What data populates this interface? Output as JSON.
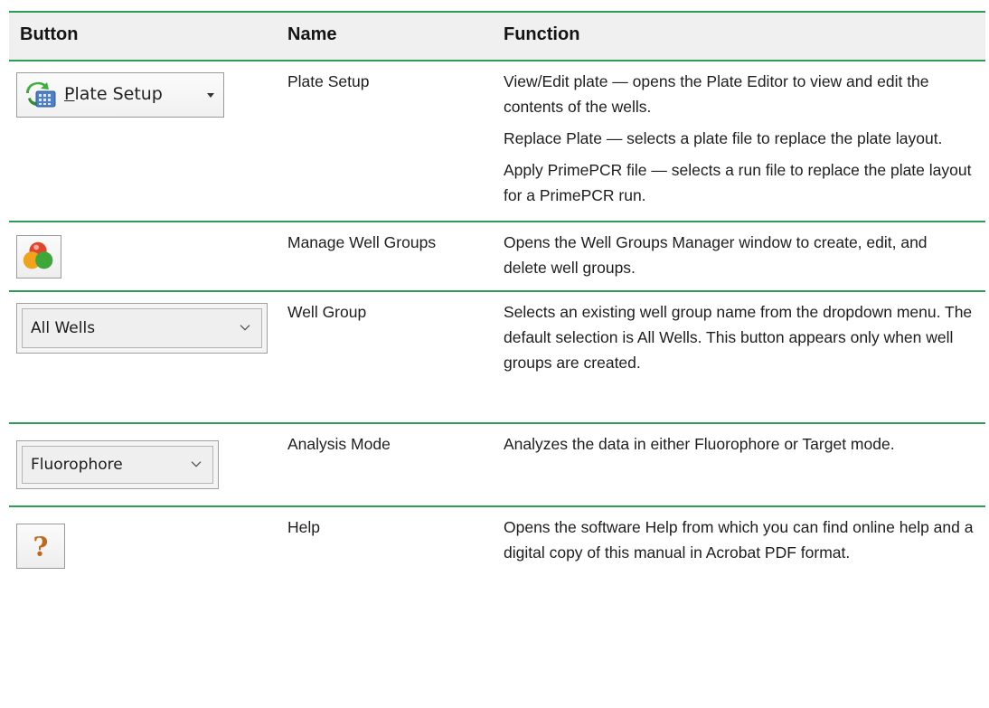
{
  "header": {
    "col_button": "Button",
    "col_name": "Name",
    "col_function": "Function"
  },
  "rows": [
    {
      "button": {
        "label": "Plate Setup",
        "icon": "plate-setup-icon",
        "has_dropdown_arrow": true
      },
      "name": "Plate Setup",
      "function": [
        "View/Edit plate — opens the Plate Editor to view and edit the contents of the wells.",
        "Replace Plate — selects a plate file to replace the plate layout.",
        "Apply PrimePCR file — selects a run file to replace the plate layout for a PrimePCR run."
      ]
    },
    {
      "button": {
        "icon": "well-groups-icon"
      },
      "name": "Manage Well Groups",
      "function": [
        "Opens the Well Groups Manager window to create, edit, and delete well groups."
      ]
    },
    {
      "button": {
        "selected": "All Wells",
        "icon": "chevron-down-icon"
      },
      "name": "Well Group",
      "function": [
        "Selects an existing well group name from the dropdown menu. The default selection is All Wells. This button appears only when well groups are created."
      ]
    },
    {
      "button": {
        "selected": "Fluorophore",
        "icon": "chevron-down-icon"
      },
      "name": "Analysis Mode",
      "function": [
        "Analyzes the data in either Fluorophore or Target mode."
      ]
    },
    {
      "button": {
        "icon": "help-question-icon"
      },
      "name": "Help",
      "function": [
        "Opens the software Help from which you can find online help and a digital copy of this manual in Acrobat PDF format."
      ]
    }
  ],
  "colors": {
    "rule": "#2e9b58",
    "header_bg": "#f0f0f0",
    "help_icon": "#c0691d"
  }
}
